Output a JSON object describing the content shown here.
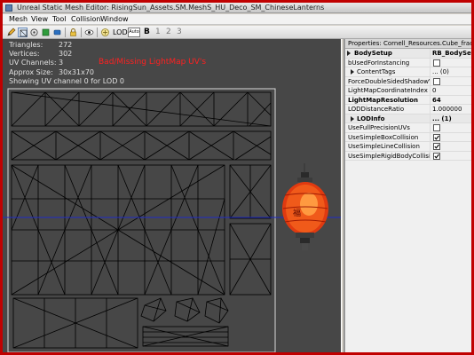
{
  "window": {
    "title": "Unreal Static Mesh Editor: RisingSun_Assets.SM.MeshS_HU_Deco_SM_ChineseLanterns",
    "icon": "unreal-app-icon"
  },
  "menu": [
    "Mesh",
    "View",
    "Tool",
    "Collision",
    "Window"
  ],
  "toolbar": {
    "lod_label": "LOD:",
    "auto_label": "Auto",
    "lod_levels": [
      "B",
      "1",
      "2",
      "3"
    ]
  },
  "viewport": {
    "stats": [
      {
        "label": "Triangles:",
        "value": "272"
      },
      {
        "label": "Vertices:",
        "value": "302"
      },
      {
        "label": "UV Channels:",
        "value": "3"
      },
      {
        "label": "Approx Size:",
        "value": "30x31x70"
      }
    ],
    "uv_info": "Showing UV channel 0 for LOD 0",
    "warning": "Bad/Missing LightMap UV's",
    "colors": {
      "background": "#474747",
      "uv_lines": "#000000",
      "horizon": "#1f2bc8",
      "lantern": "#e03a10"
    }
  },
  "properties": {
    "header": "Properties: Cornell_Resources.Cube_fractured",
    "rows": [
      {
        "name": "BodySetup",
        "value": "RB_BodySetup",
        "type": "category"
      },
      {
        "name": "bUsedForInstancing",
        "type": "check",
        "checked": false
      },
      {
        "name": "ContentTags",
        "value": "... (0)",
        "type": "subcat"
      },
      {
        "name": "ForceDoubleSidedShadowVolumes",
        "type": "check",
        "checked": false
      },
      {
        "name": "LightMapCoordinateIndex",
        "value": "0",
        "type": "value"
      },
      {
        "name": "LightMapResolution",
        "value": "64",
        "type": "bold"
      },
      {
        "name": "LODDistanceRatio",
        "value": "1.000000",
        "type": "value"
      },
      {
        "name": "LODInfo",
        "value": "... (1)",
        "type": "category"
      },
      {
        "name": "UseFullPrecisionUVs",
        "type": "check",
        "checked": false
      },
      {
        "name": "UseSimpleBoxCollision",
        "type": "check",
        "checked": true
      },
      {
        "name": "UseSimpleLineCollision",
        "type": "check",
        "checked": true
      },
      {
        "name": "UseSimpleRigidBodyCollision",
        "type": "check",
        "checked": true
      }
    ]
  }
}
